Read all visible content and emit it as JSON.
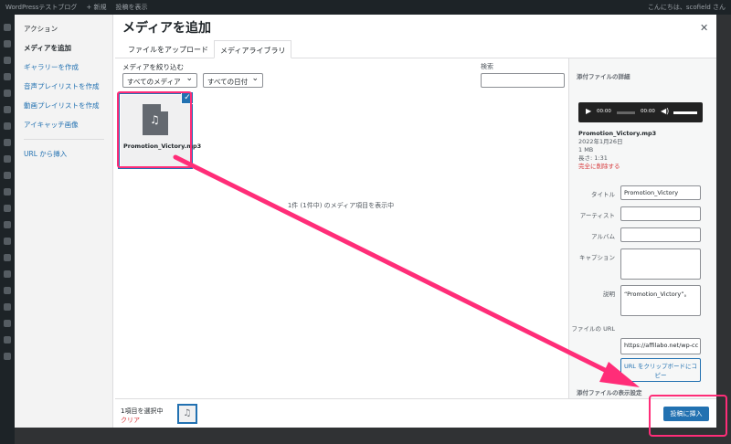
{
  "adminbar": {
    "site": "WordPressテストブログ",
    "new": "+ 新規",
    "view_post": "投稿を表示",
    "greeting": "こんにちは、scofield さん"
  },
  "sidebar": {
    "heading": "アクション",
    "items": [
      {
        "label": "メディアを追加"
      },
      {
        "label": "ギャラリーを作成"
      },
      {
        "label": "音声プレイリストを作成"
      },
      {
        "label": "動画プレイリストを作成"
      },
      {
        "label": "アイキャッチ画像"
      },
      {
        "label": "URL から挿入"
      }
    ]
  },
  "modal": {
    "title": "メディアを追加",
    "close_icon": "close-icon"
  },
  "tabs": [
    {
      "label": "ファイルをアップロード"
    },
    {
      "label": "メディアライブラリ"
    }
  ],
  "filters": {
    "label": "メディアを絞り込む",
    "type": "すべてのメディア",
    "date": "すべての日付",
    "search_label": "検索"
  },
  "attachment": {
    "filename": "Promotion_Victory.mp3",
    "icon": "audio-file-icon"
  },
  "count_text": "1件 (1件中) のメディア項目を表示中",
  "details": {
    "heading": "添付ファイルの詳細",
    "player": {
      "current": "00:00",
      "total": "00:00"
    },
    "filename": "Promotion_Victory.mp3",
    "date": "2022年1月26日",
    "size": "1 MB",
    "length": "長さ: 1:31",
    "delete": "完全に削除する",
    "fields": {
      "title_label": "タイトル",
      "title_value": "Promotion_Victory",
      "artist_label": "アーティスト",
      "album_label": "アルバム",
      "caption_label": "キャプション",
      "desc_label": "説明",
      "desc_value": "“Promotion_Victory”。",
      "url_label": "ファイルの URL",
      "url_value": "https://affilabo.net/wp-cc"
    },
    "copy_button": "URL をクリップボードにコピー",
    "display_heading": "添付ファイルの表示設定"
  },
  "toolbar": {
    "selected": "1項目を選択中",
    "clear": "クリア",
    "insert": "投稿に挿入"
  },
  "colors": {
    "accent": "#2271b1",
    "annotation": "#ff2d78"
  }
}
